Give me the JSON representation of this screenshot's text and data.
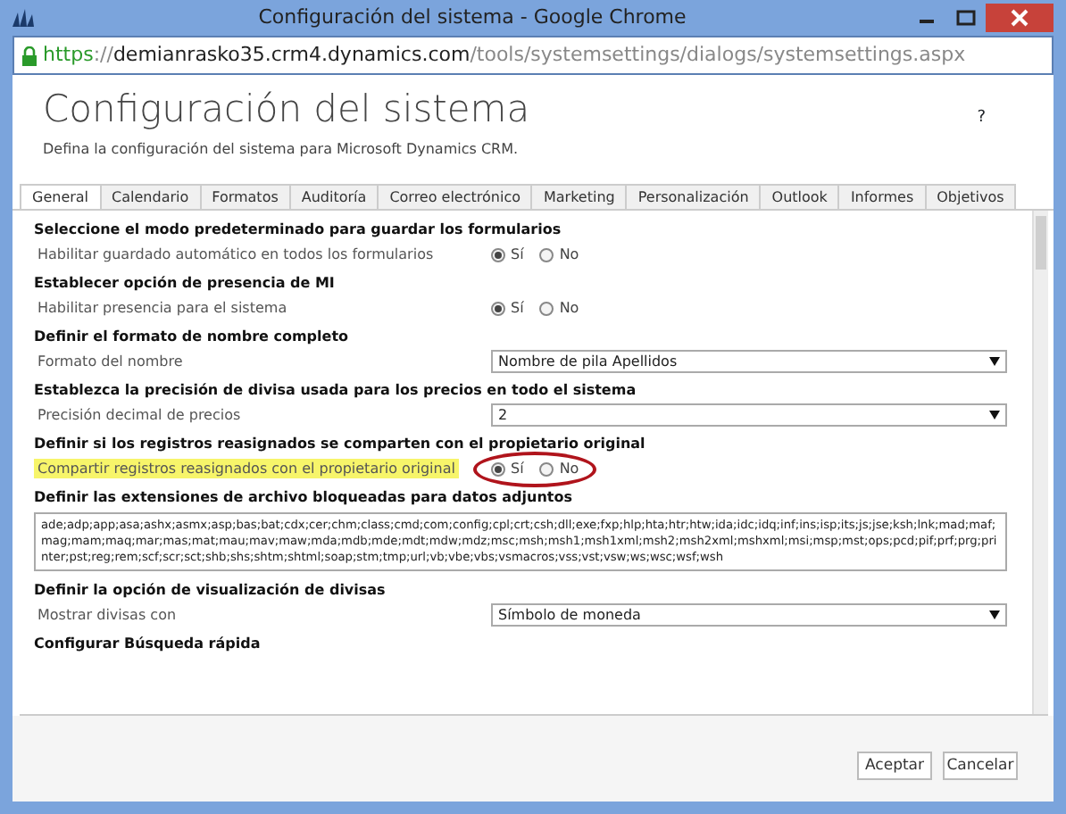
{
  "window": {
    "title": "Configuración del sistema - Google Chrome"
  },
  "address_bar": {
    "scheme": "https",
    "separator": "://",
    "host": "demianrasko35.crm4.dynamics.com",
    "path": "/tools/systemsettings/dialogs/systemsettings.aspx"
  },
  "page": {
    "title": "Configuración del sistema",
    "subtitle": "Defina la configuración del sistema para Microsoft Dynamics CRM.",
    "help": "?"
  },
  "tabs": [
    {
      "label": "General",
      "selected": true
    },
    {
      "label": "Calendario",
      "selected": false
    },
    {
      "label": "Formatos",
      "selected": false
    },
    {
      "label": "Auditoría",
      "selected": false
    },
    {
      "label": "Correo electrónico",
      "selected": false
    },
    {
      "label": "Marketing",
      "selected": false
    },
    {
      "label": "Personalización",
      "selected": false
    },
    {
      "label": "Outlook",
      "selected": false
    },
    {
      "label": "Informes",
      "selected": false
    },
    {
      "label": "Objetivos",
      "selected": false
    }
  ],
  "sections": [
    {
      "heading": "Seleccione el modo predeterminado para guardar los formularios",
      "fields": [
        {
          "kind": "radio",
          "label": "Habilitar guardado automático en todos los formularios",
          "highlighted": false,
          "circled": false,
          "options": [
            {
              "label": "Sí",
              "selected": true
            },
            {
              "label": "No",
              "selected": false
            }
          ]
        }
      ]
    },
    {
      "heading": "Establecer opción de presencia de MI",
      "fields": [
        {
          "kind": "radio",
          "label": "Habilitar presencia para el sistema",
          "highlighted": false,
          "circled": false,
          "options": [
            {
              "label": "Sí",
              "selected": true
            },
            {
              "label": "No",
              "selected": false
            }
          ]
        }
      ]
    },
    {
      "heading": "Definir el formato de nombre completo",
      "fields": [
        {
          "kind": "select",
          "label": "Formato del nombre",
          "value": "Nombre de pila Apellidos",
          "highlighted": false
        }
      ]
    },
    {
      "heading": "Establezca la precisión de divisa usada para los precios en todo el sistema",
      "fields": [
        {
          "kind": "select",
          "label": "Precisión decimal de precios",
          "value": "2",
          "highlighted": false
        }
      ]
    },
    {
      "heading": "Definir si los registros reasignados se comparten con el propietario original",
      "fields": [
        {
          "kind": "radio",
          "label": "Compartir registros reasignados con el propietario original",
          "highlighted": true,
          "circled": true,
          "options": [
            {
              "label": "Sí",
              "selected": true
            },
            {
              "label": "No",
              "selected": false
            }
          ]
        }
      ]
    },
    {
      "heading": "Definir las extensiones de archivo bloqueadas para datos adjuntos",
      "fields": [
        {
          "kind": "textarea",
          "value": "ade;adp;app;asa;ashx;asmx;asp;bas;bat;cdx;cer;chm;class;cmd;com;config;cpl;crt;csh;dll;exe;fxp;hlp;hta;htr;htw;ida;idc;idq;inf;ins;isp;its;js;jse;ksh;lnk;mad;maf;mag;mam;maq;mar;mas;mat;mau;mav;maw;mda;mdb;mde;mdt;mdw;mdz;msc;msh;msh1;msh1xml;msh2;msh2xml;mshxml;msi;msp;mst;ops;pcd;pif;prf;prg;printer;pst;reg;rem;scf;scr;sct;shb;shs;shtm;shtml;soap;stm;tmp;url;vb;vbe;vbs;vsmacros;vss;vst;vsw;ws;wsc;wsf;wsh"
        }
      ]
    },
    {
      "heading": "Definir la opción de visualización de divisas",
      "fields": [
        {
          "kind": "select",
          "label": "Mostrar divisas con",
          "value": "Símbolo de moneda",
          "highlighted": false
        }
      ]
    },
    {
      "heading": "Configurar Búsqueda rápida"
    }
  ],
  "buttons": [
    {
      "label": "Aceptar"
    },
    {
      "label": "Cancelar"
    }
  ]
}
